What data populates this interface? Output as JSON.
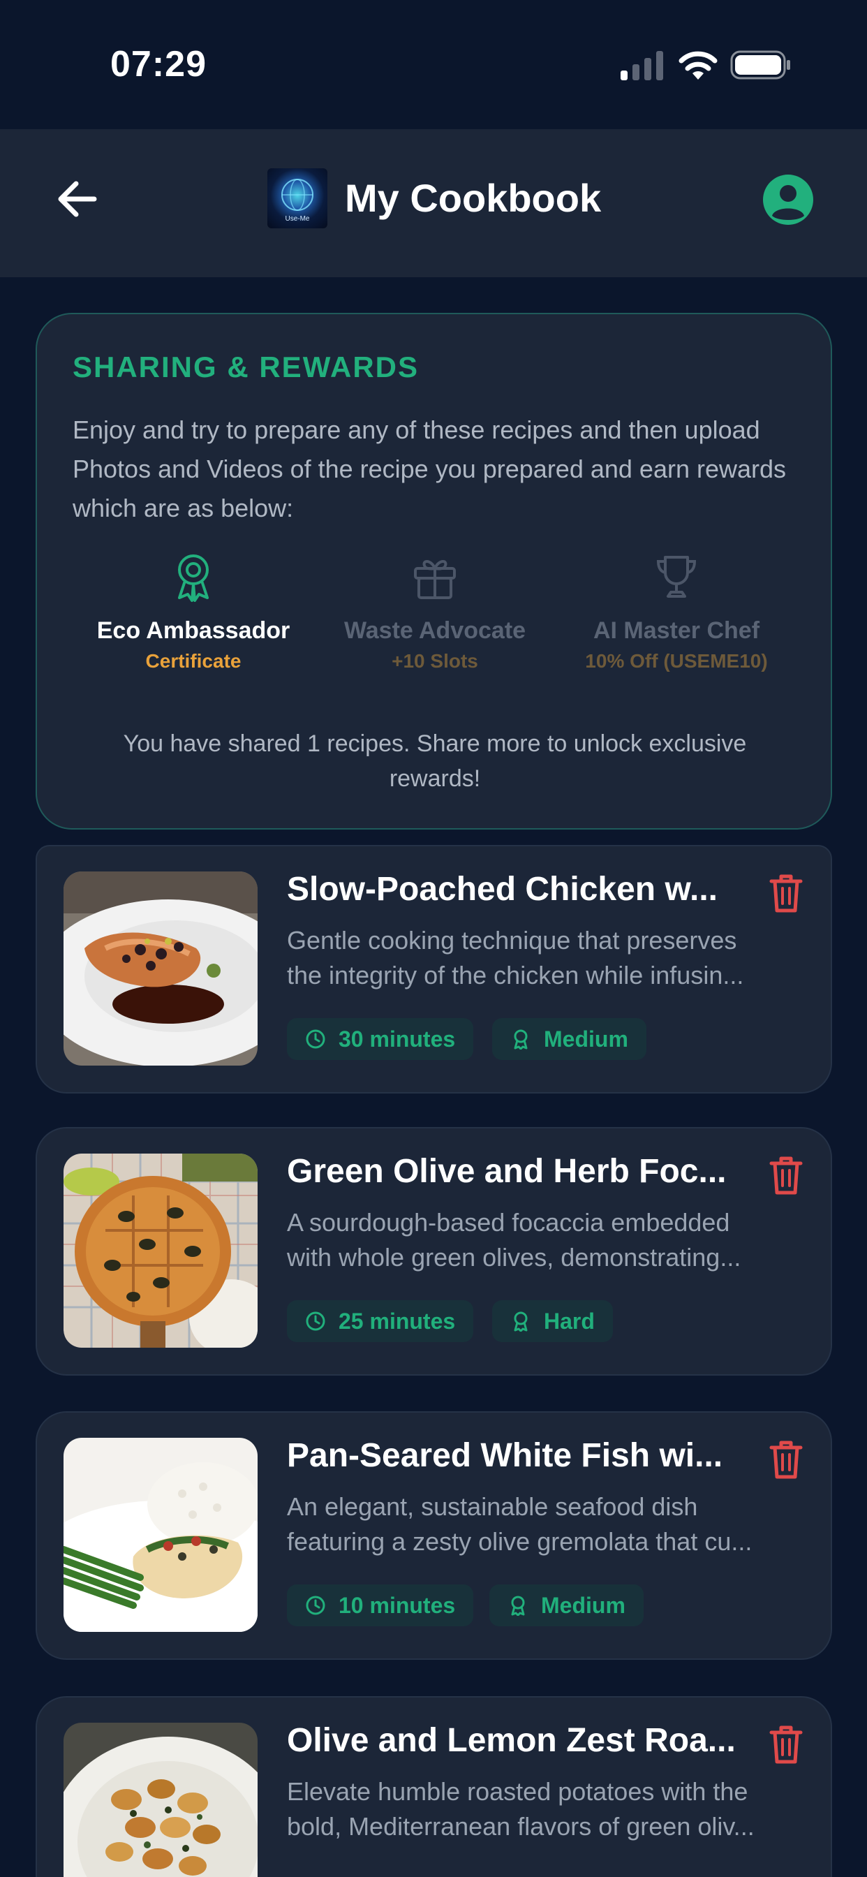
{
  "status_bar": {
    "time": "07:29"
  },
  "header": {
    "title": "My Cookbook",
    "logo_text": "Use-Me"
  },
  "rewards": {
    "title": "SHARING & REWARDS",
    "description": "Enjoy and try to prepare any of these recipes and then upload Photos and Videos of the recipe you prepared and earn rewards which are as below:",
    "items": [
      {
        "name": "Eco Ambassador",
        "perk": "Certificate",
        "icon": "award-ribbon-icon",
        "unlocked": true
      },
      {
        "name": "Waste Advocate",
        "perk": "+10 Slots",
        "icon": "gift-icon",
        "unlocked": false
      },
      {
        "name": "AI Master Chef",
        "perk": "10% Off (USEME10)",
        "icon": "trophy-icon",
        "unlocked": false
      }
    ],
    "footer": "You have shared 1 recipes. Share more to unlock exclusive rewards!"
  },
  "recipes": [
    {
      "title": "Slow-Poached Chicken w...",
      "description_lines": [
        "Gentle cooking technique that preserves",
        "the integrity of the chicken while infusin..."
      ],
      "time": "30 minutes",
      "difficulty": "Medium"
    },
    {
      "title": "Green Olive and Herb Foc...",
      "description_lines": [
        "A sourdough-based focaccia embedded",
        "with whole green olives, demonstrating..."
      ],
      "time": "25 minutes",
      "difficulty": "Hard"
    },
    {
      "title": "Pan-Seared White Fish wi...",
      "description_lines": [
        "An elegant, sustainable seafood dish",
        "featuring a zesty olive gremolata that cu..."
      ],
      "time": "10 minutes",
      "difficulty": "Medium"
    },
    {
      "title": "Olive and Lemon Zest Roa...",
      "description_lines": [
        "Elevate humble roasted potatoes with the",
        "bold, Mediterranean flavors of green oliv..."
      ],
      "time": "",
      "difficulty": ""
    }
  ],
  "colors": {
    "accent": "#22b07d",
    "background": "#0b162c",
    "card": "#1c2638",
    "delete": "#e04a4a",
    "reward_perk": "#e9a23b"
  }
}
